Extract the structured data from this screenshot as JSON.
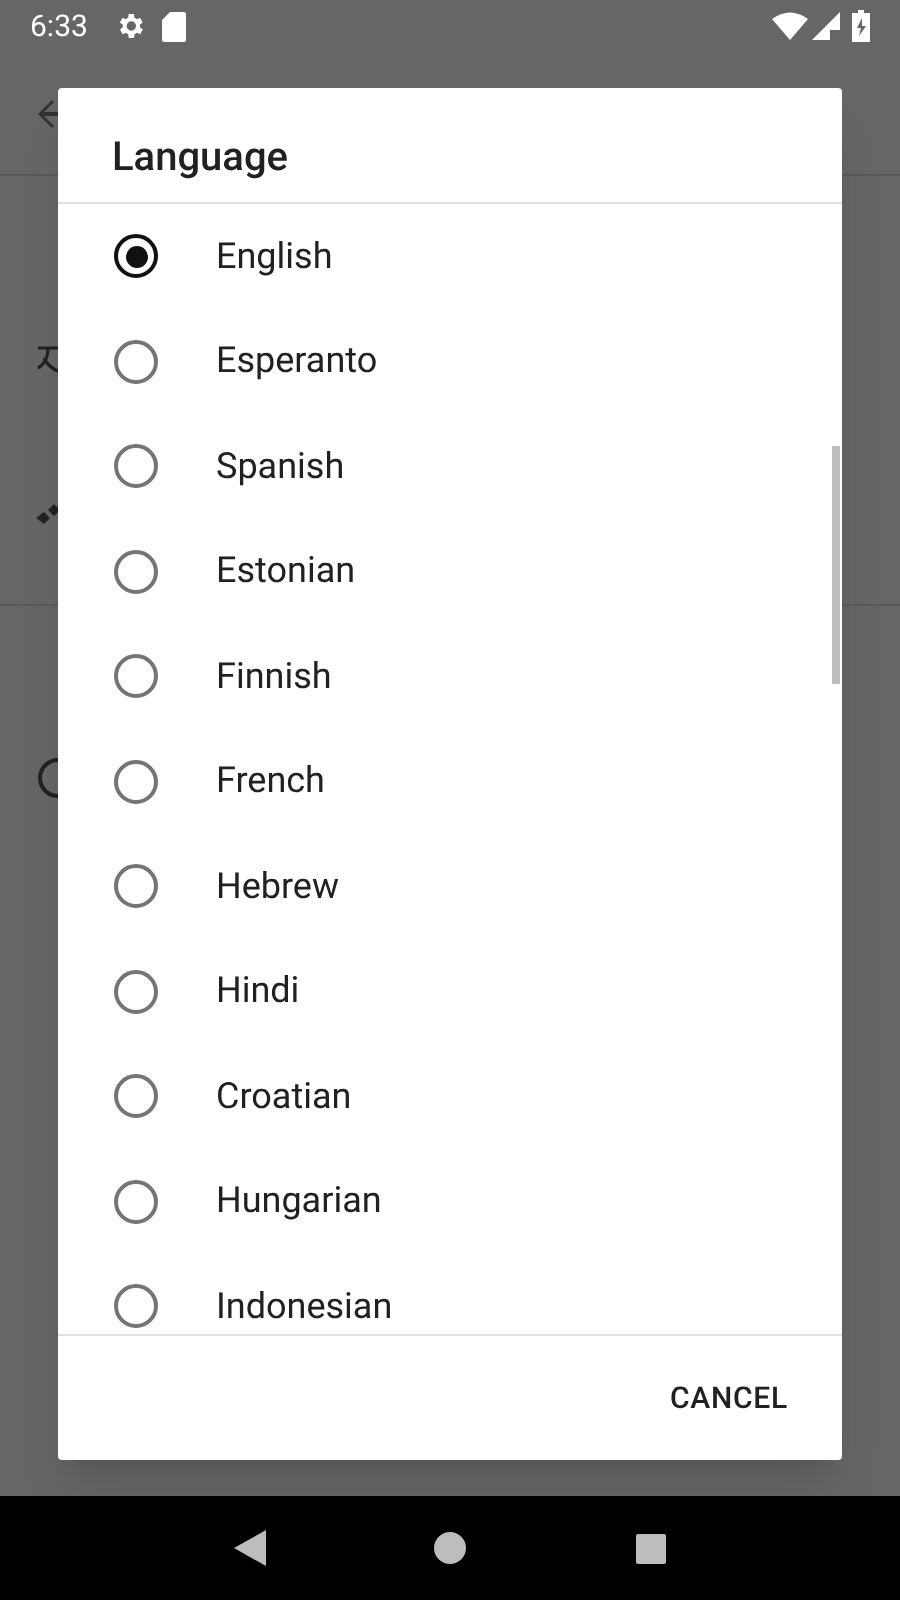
{
  "status_bar": {
    "time": "6:33"
  },
  "dialog": {
    "title": "Language",
    "options": [
      {
        "label": "English",
        "selected": true
      },
      {
        "label": "Esperanto",
        "selected": false
      },
      {
        "label": "Spanish",
        "selected": false
      },
      {
        "label": "Estonian",
        "selected": false
      },
      {
        "label": "Finnish",
        "selected": false
      },
      {
        "label": "French",
        "selected": false
      },
      {
        "label": "Hebrew",
        "selected": false
      },
      {
        "label": "Hindi",
        "selected": false
      },
      {
        "label": "Croatian",
        "selected": false
      },
      {
        "label": "Hungarian",
        "selected": false
      },
      {
        "label": "Indonesian",
        "selected": false
      }
    ],
    "buttons": [
      "CANCEL"
    ]
  }
}
